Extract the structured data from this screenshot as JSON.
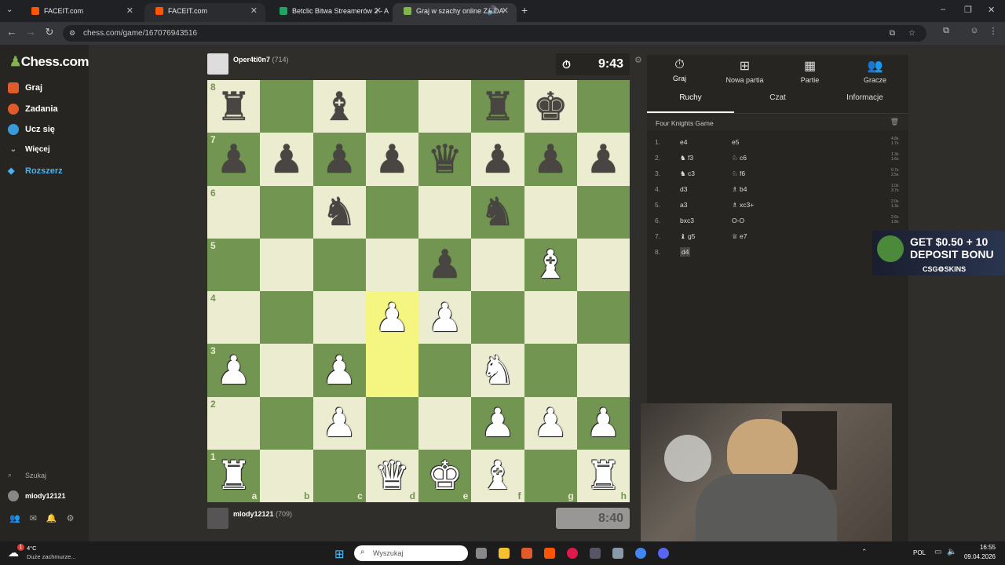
{
  "browser": {
    "tabs": [
      {
        "title": "FACEIT.com",
        "color": "#ff5500"
      },
      {
        "title": "FACEIT.com",
        "color": "#ff5500"
      },
      {
        "title": "Betclic Bitwa Streamerów 2 - A",
        "color": "#21a366"
      },
      {
        "title": "Graj w szachy online ZA DA",
        "color": "#81b64c"
      }
    ],
    "url": "chess.com/game/167076943516"
  },
  "sidebar": {
    "logo": "Chess.com",
    "items": [
      {
        "label": "Graj",
        "color": "#e05a2b"
      },
      {
        "label": "Zadania",
        "color": "#e05a2b"
      },
      {
        "label": "Ucz się",
        "color": "#3a9ad9"
      },
      {
        "label": "Więcej",
        "color": "#aaaaaa"
      },
      {
        "label": "Rozszerz",
        "color": "#4ab2f0"
      }
    ],
    "search": "Szukaj",
    "user": "mlody12121"
  },
  "top_player": {
    "name": "Oper4ti0n7",
    "rating": "(714)",
    "clock": "9:43"
  },
  "bottom_player": {
    "name": "mlody12121",
    "rating": "(709)",
    "clock": "8:40"
  },
  "board": {
    "highlight": [
      "d3",
      "d4"
    ],
    "ranks": [
      "8",
      "7",
      "6",
      "5",
      "4",
      "3",
      "2",
      "1"
    ],
    "files": [
      "a",
      "b",
      "c",
      "d",
      "e",
      "f",
      "g",
      "h"
    ],
    "rows": [
      [
        "bR",
        "",
        "bB",
        "",
        "",
        "bR",
        "bK",
        ""
      ],
      [
        "bP",
        "bP",
        "bP",
        "bP",
        "bQ",
        "bP",
        "bP",
        "bP"
      ],
      [
        "",
        "",
        "bN",
        "",
        "",
        "bN",
        "",
        ""
      ],
      [
        "",
        "",
        "",
        "",
        "bP",
        "",
        "wB",
        ""
      ],
      [
        "",
        "",
        "",
        "wP",
        "wP",
        "",
        "",
        ""
      ],
      [
        "wP",
        "",
        "wP",
        "",
        "",
        "wN",
        "",
        ""
      ],
      [
        "",
        "",
        "wP",
        "",
        "",
        "wP",
        "wP",
        "wP"
      ],
      [
        "wR",
        "",
        "",
        "wQ",
        "wK",
        "wB",
        "",
        "wR"
      ]
    ]
  },
  "panel": {
    "top_tabs": [
      "Graj",
      "Nowa partia",
      "Partie",
      "Gracze"
    ],
    "sub_tabs": [
      "Ruchy",
      "Czat",
      "Informacje"
    ],
    "opening": "Four Knights Game",
    "moves": [
      {
        "n": "1.",
        "w": "e4",
        "b": "e5",
        "t": [
          "4.8s",
          "1.7s"
        ]
      },
      {
        "n": "2.",
        "w": "♞ f3",
        "b": "♘ c6",
        "t": [
          "1.3s",
          "1.6s"
        ]
      },
      {
        "n": "3.",
        "w": "♞ c3",
        "b": "♘ f6",
        "t": [
          "0.7s",
          "2.5s"
        ]
      },
      {
        "n": "4.",
        "w": "d3",
        "b": "♗ b4",
        "t": [
          "1.0s",
          "3.7s"
        ]
      },
      {
        "n": "5.",
        "w": "a3",
        "b": "♗ xc3+",
        "t": [
          "2.0s",
          "1.3s"
        ]
      },
      {
        "n": "6.",
        "w": "bxc3",
        "b": "O-O",
        "t": [
          "2.6s",
          "1.8s"
        ]
      },
      {
        "n": "7.",
        "w": "♝ g5",
        "b": "♕ e7",
        "t": [
          "",
          ""
        ]
      },
      {
        "n": "8.",
        "w": "d4",
        "b": "",
        "t": [
          "",
          ""
        ]
      }
    ]
  },
  "ad": {
    "line1": "GET $0.50 + 10",
    "line2": "DEPOSIT BONU",
    "brand": "CSG⚙SKINS"
  },
  "taskbar": {
    "weather_temp": "4°C",
    "weather_desc": "Duże zachmurze...",
    "search": "Wyszukaj",
    "lang": "POL",
    "time": "16:55",
    "date": "09.04.2026"
  }
}
